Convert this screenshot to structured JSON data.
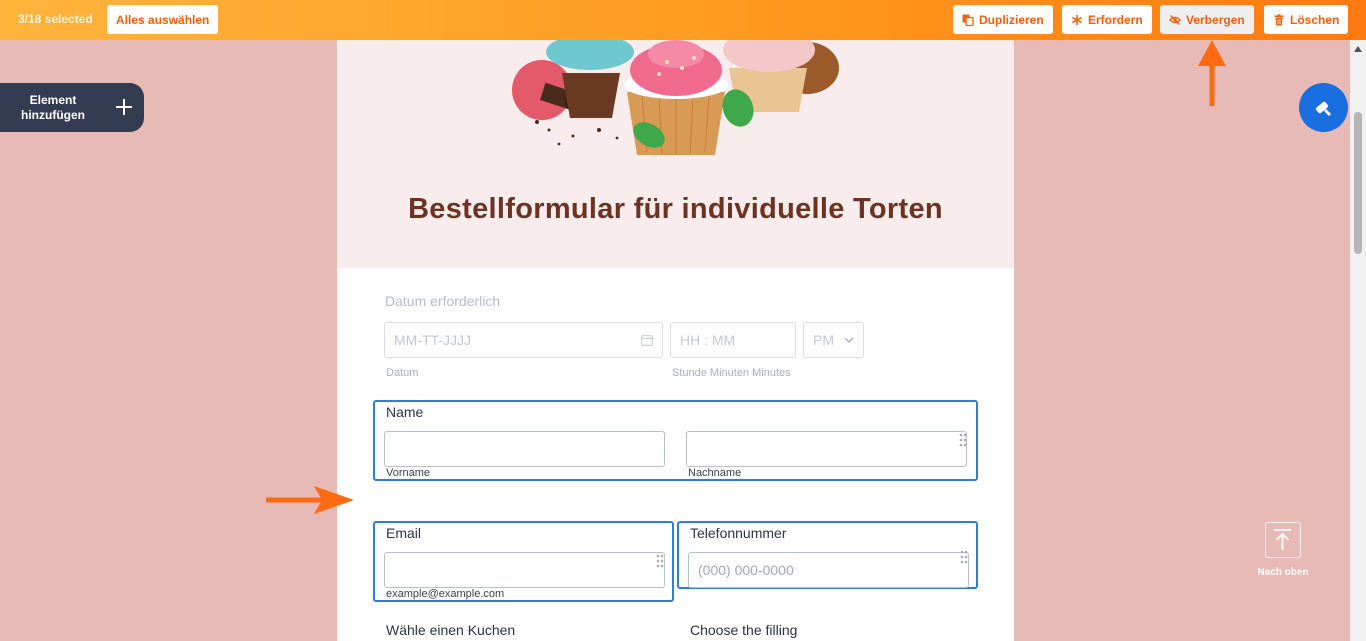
{
  "topbar": {
    "selected_count": "3/18 selected",
    "select_all": "Alles auswählen",
    "actions": {
      "duplicate": "Duplizieren",
      "require": "Erfordern",
      "hide": "Verbergen",
      "delete": "Löschen"
    }
  },
  "sidebar": {
    "add_element_line1": "Element",
    "add_element_line2": "hinzufügen"
  },
  "form": {
    "title": "Bestellformular für individuelle Torten",
    "date": {
      "label": "Datum erforderlich",
      "date_placeholder": "MM-TT-JJJJ",
      "time_placeholder": "HH : MM",
      "ampm": "PM",
      "date_sublabel": "Datum",
      "time_sublabel": "Stunde Minuten Minutes"
    },
    "name": {
      "label": "Name",
      "first_sublabel": "Vorname",
      "last_sublabel": "Nachname"
    },
    "email": {
      "label": "Email",
      "sublabel": "example@example.com"
    },
    "phone": {
      "label": "Telefonnummer",
      "placeholder": "(000) 000-0000"
    },
    "cake": {
      "label": "Wähle einen Kuchen"
    },
    "filling": {
      "label": "Choose the filling"
    }
  },
  "right": {
    "back_to_top": "Nach oben"
  },
  "colors": {
    "topbar_start": "#ffb43d",
    "topbar_end": "#ff7a10",
    "accent": "#f2600c",
    "background": "#e8bab5",
    "title": "#6b3322",
    "selection": "#2f7fd0",
    "fab": "#1a6fe0"
  },
  "icons": [
    "duplicate-icon",
    "asterisk-icon",
    "eye-off-icon",
    "trash-icon",
    "plus-icon",
    "calendar-icon",
    "chevron-down-icon",
    "drag-handle-icon",
    "paint-roller-icon",
    "arrow-up-icon"
  ]
}
